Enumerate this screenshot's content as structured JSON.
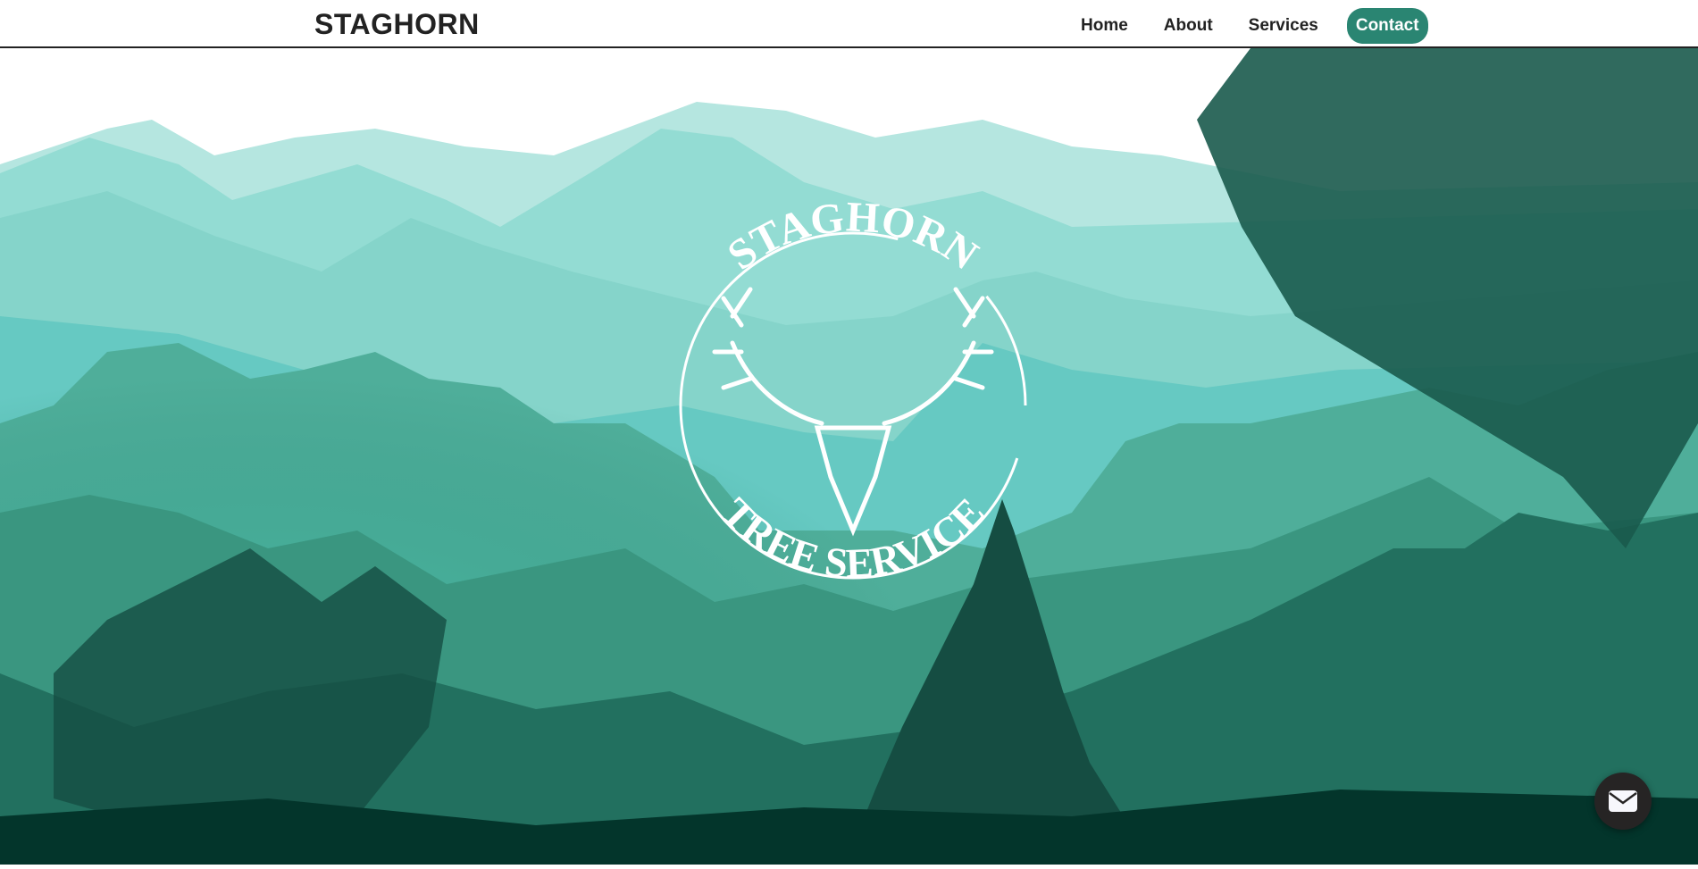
{
  "header": {
    "brand": "STAGHORN",
    "nav": [
      {
        "label": "Home"
      },
      {
        "label": "About"
      },
      {
        "label": "Services"
      },
      {
        "label": "Contact"
      }
    ]
  },
  "hero": {
    "logo_top": "STAGHORN",
    "logo_bottom": "TREE SERVICE"
  },
  "colors": {
    "accent": "#2a8572",
    "dark": "#262424"
  },
  "fab": {
    "icon": "envelope-icon"
  }
}
